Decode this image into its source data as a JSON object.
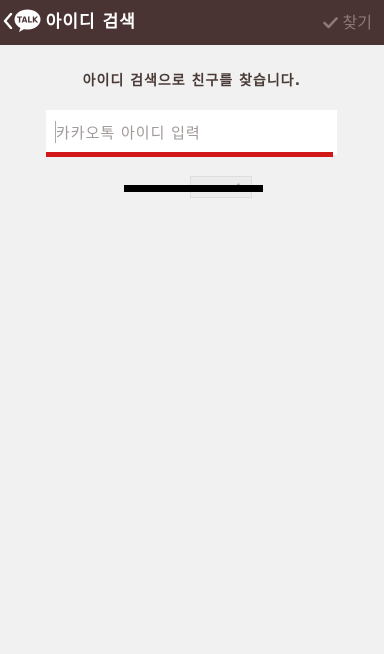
{
  "header": {
    "back_icon": "chevron-left-icon",
    "logo_text": "TALK",
    "title": "아이디 검색",
    "find_label": "찾기",
    "find_icon": "check-icon",
    "colors": {
      "bar": "#4a3333",
      "title": "#ffffff",
      "find": "#8c7a75"
    }
  },
  "main": {
    "heading": "아이디 검색으로 친구를 찾습니다.",
    "search": {
      "placeholder": "카카오톡 아이디 입력",
      "value": "",
      "underline_color": "#d01818"
    }
  }
}
